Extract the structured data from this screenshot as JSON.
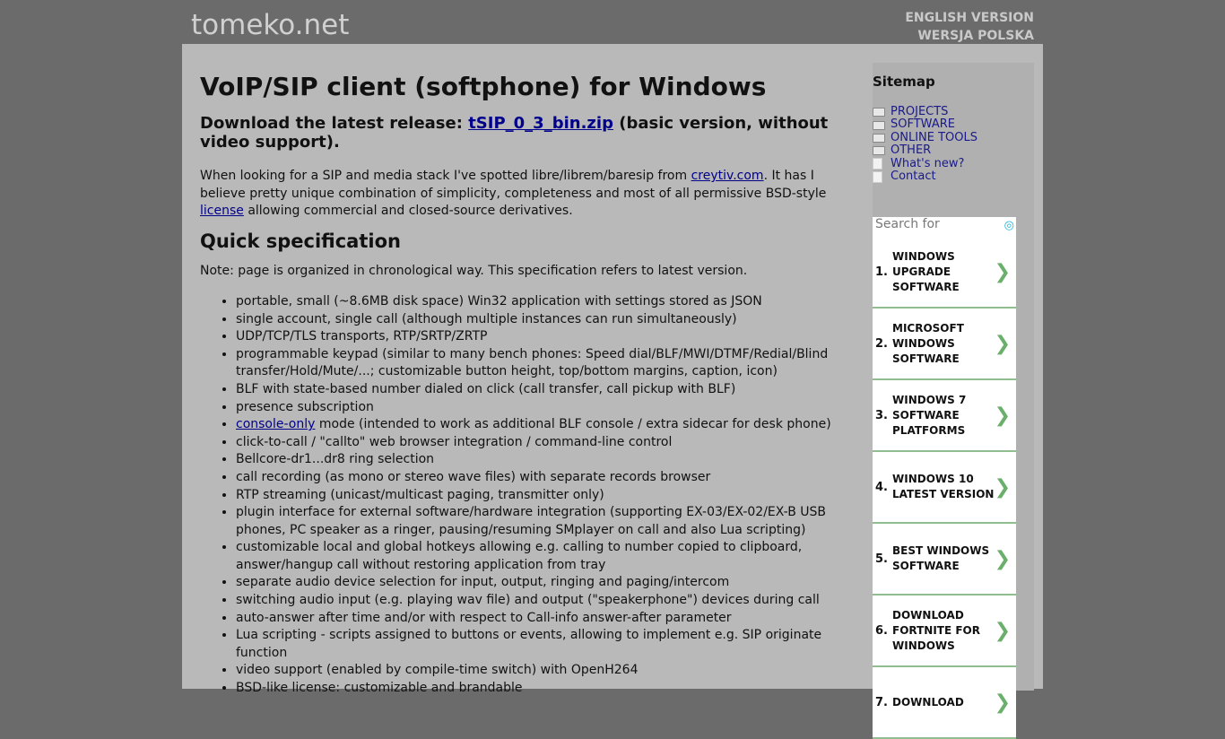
{
  "header": {
    "logo": "tomeko.net",
    "lang_en": "ENGLISH VERSION",
    "lang_pl": "WERSJA POLSKA"
  },
  "main": {
    "title": "VoIP/SIP client (softphone) for Windows",
    "download_prefix": "Download the latest release: ",
    "download_link": "tSIP_0_3_bin.zip",
    "download_suffix": " (basic version, without video support).",
    "intro_1": "When looking for a SIP and media stack I've spotted libre/librem/baresip from ",
    "intro_link1": "creytiv.com",
    "intro_2": ". It has I believe pretty unique combination of simplicity, completeness and most of all permissive BSD-style ",
    "intro_link2": "license",
    "intro_3": " allowing commercial and closed-source derivatives.",
    "spec_heading": "Quick specification",
    "note": "Note: page is organized in chronological way. This specification refers to latest version.",
    "console_link": "console-only",
    "console_rest": " mode (intended to work as additional BLF console / extra sidecar for desk phone)",
    "items": [
      "portable, small (~8.6MB disk space) Win32 application with settings stored as JSON",
      "single account, single call (although multiple instances can run simultaneously)",
      "UDP/TCP/TLS transports, RTP/SRTP/ZRTP",
      "programmable keypad (similar to many bench phones: Speed dial/BLF/MWI/DTMF/Redial/Blind transfer/Hold/Mute/...; customizable button height, top/bottom margins, caption, icon)",
      "BLF with state-based number dialed on click (call transfer, call pickup with BLF)",
      "presence subscription"
    ],
    "items2": [
      "click-to-call / \"callto\" web browser integration / command-line control",
      "Bellcore-dr1...dr8 ring selection",
      "call recording (as mono or stereo wave files) with separate records browser",
      "RTP streaming (unicast/multicast paging, transmitter only)",
      "plugin interface for external software/hardware integration (supporting EX-03/EX-02/EX-B USB phones, PC speaker as a ringer, pausing/resuming SMplayer on call and also Lua scripting)",
      "customizable local and global hotkeys allowing e.g. calling to number copied to clipboard, answer/hangup call without restoring application from tray",
      "separate audio device selection for input, output, ringing and paging/intercom",
      "switching audio input (e.g. playing wav file) and output (\"speakerphone\") devices during call",
      "auto-answer after time and/or with respect to Call-info answer-after parameter",
      "Lua scripting - scripts assigned to buttons or events, allowing to implement e.g. SIP originate function",
      "video support (enabled by compile-time switch) with OpenH264",
      "BSD-like license: customizable and brandable"
    ]
  },
  "sitemap": {
    "title": "Sitemap",
    "items": [
      {
        "label": "PROJECTS",
        "icon": "folder-icon"
      },
      {
        "label": "SOFTWARE",
        "icon": "folder-icon"
      },
      {
        "label": "ONLINE TOOLS",
        "icon": "folder-icon"
      },
      {
        "label": "OTHER",
        "icon": "folder-icon"
      },
      {
        "label": "What's new?",
        "icon": "file-icon"
      },
      {
        "label": "Contact",
        "icon": "file-icon"
      }
    ]
  },
  "ad": {
    "search_label": "Search for",
    "items": [
      {
        "num": "1.",
        "text": "WINDOWS UPGRADE SOFTWARE"
      },
      {
        "num": "2.",
        "text": "MICROSOFT WINDOWS SOFTWARE"
      },
      {
        "num": "3.",
        "text": "WINDOWS 7 SOFTWARE PLATFORMS"
      },
      {
        "num": "4.",
        "text": "WINDOWS 10 LATEST VERSION"
      },
      {
        "num": "5.",
        "text": "BEST WINDOWS SOFTWARE"
      },
      {
        "num": "6.",
        "text": "DOWNLOAD FORTNITE FOR WINDOWS"
      },
      {
        "num": "7.",
        "text": "DOWNLOAD"
      }
    ]
  },
  "colors": {
    "page_bg": "#6b6b6b",
    "content_bg": "#b9b9b9",
    "link": "#00008b",
    "ad_divider": "#8fbf8f"
  }
}
